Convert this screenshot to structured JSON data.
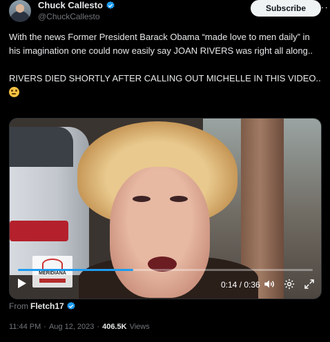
{
  "author": {
    "name": "Chuck Callesto",
    "handle": "@ChuckCallesto"
  },
  "header": {
    "subscribe_label": "Subscribe",
    "more_label": "···"
  },
  "tweet": {
    "line1": "With the news Former President Barack Obama “made love to men daily” in his imagination one could now easily say JOAN RIVERS was right all along..",
    "line2": "RIVERS DIED SHORTLY AFTER CALLING OUT MICHELLE IN THIS VIDEO.."
  },
  "video": {
    "watermark": "MERIDIANA",
    "time": "0:14 / 0:36",
    "progress": 0.39
  },
  "source": {
    "prefix": "From",
    "name": "Fletch17"
  },
  "meta": {
    "time": "11:44 PM",
    "sep1": "·",
    "date": "Aug 12, 2023",
    "sep2": "·",
    "views_count": "406.5K",
    "views_label": "Views"
  },
  "colors": {
    "accent": "#1d9bf0",
    "background": "#000000",
    "text": "#e7e9ea",
    "muted": "#71767b"
  }
}
